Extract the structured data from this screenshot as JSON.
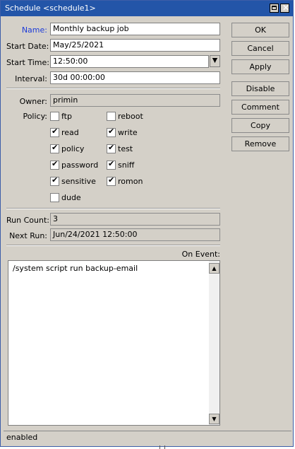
{
  "window": {
    "title": "Schedule <schedule1>",
    "close_glyph": "✕"
  },
  "form": {
    "name": {
      "label": "Name:",
      "value": "Monthly backup job"
    },
    "start_date": {
      "label": "Start Date:",
      "value": "May/25/2021"
    },
    "start_time": {
      "label": "Start Time:",
      "value": "12:50:00"
    },
    "interval": {
      "label": "Interval:",
      "value": "30d 00:00:00"
    },
    "owner": {
      "label": "Owner:",
      "value": "primin"
    },
    "policy_label": "Policy:",
    "policies": [
      {
        "label": "ftp",
        "checked": false
      },
      {
        "label": "reboot",
        "checked": false
      },
      {
        "label": "read",
        "checked": true
      },
      {
        "label": "write",
        "checked": true
      },
      {
        "label": "policy",
        "checked": true
      },
      {
        "label": "test",
        "checked": true
      },
      {
        "label": "password",
        "checked": true
      },
      {
        "label": "sniff",
        "checked": true
      },
      {
        "label": "sensitive",
        "checked": true
      },
      {
        "label": "romon",
        "checked": true
      },
      {
        "label": "dude",
        "checked": false
      }
    ],
    "run_count": {
      "label": "Run Count:",
      "value": "3"
    },
    "next_run": {
      "label": "Next Run:",
      "value": "Jun/24/2021 12:50:00"
    },
    "on_event": {
      "label": "On Event:",
      "value": "/system script run backup-email"
    }
  },
  "buttons": {
    "ok": "OK",
    "cancel": "Cancel",
    "apply": "Apply",
    "disable": "Disable",
    "comment": "Comment",
    "copy": "Copy",
    "remove": "Remove"
  },
  "status": "enabled"
}
